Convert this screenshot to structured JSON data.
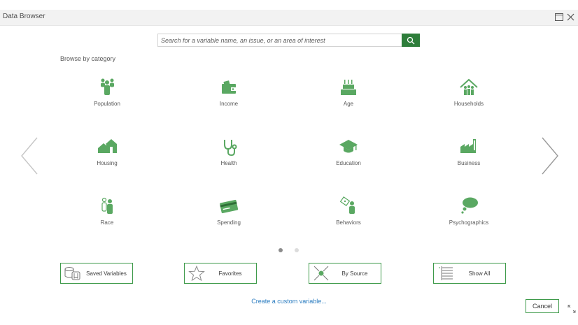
{
  "window": {
    "title": "Data Browser",
    "maximize_icon": "maximize-icon",
    "close_icon": "close-icon"
  },
  "search": {
    "placeholder": "Search for a variable name, an issue, or an area of interest",
    "value": "",
    "button_icon": "search-icon"
  },
  "browse_label": "Browse by category",
  "categories": [
    {
      "label": "Population",
      "icon": "population-icon"
    },
    {
      "label": "Income",
      "icon": "income-icon"
    },
    {
      "label": "Age",
      "icon": "age-icon"
    },
    {
      "label": "Households",
      "icon": "households-icon"
    },
    {
      "label": "Housing",
      "icon": "housing-icon"
    },
    {
      "label": "Health",
      "icon": "health-icon"
    },
    {
      "label": "Education",
      "icon": "education-icon"
    },
    {
      "label": "Business",
      "icon": "business-icon"
    },
    {
      "label": "Race",
      "icon": "race-icon"
    },
    {
      "label": "Spending",
      "icon": "spending-icon"
    },
    {
      "label": "Behaviors",
      "icon": "behaviors-icon"
    },
    {
      "label": "Psychographics",
      "icon": "psychographics-icon"
    }
  ],
  "pagination": {
    "pages": 2,
    "current": 1
  },
  "bottom_buttons": [
    {
      "label": "Saved Variables",
      "icon": "saved-variables-icon"
    },
    {
      "label": "Favorites",
      "icon": "star-icon"
    },
    {
      "label": "By Source",
      "icon": "source-icon"
    },
    {
      "label": "Show All",
      "icon": "list-icon"
    }
  ],
  "custom_link": "Create a custom variable...",
  "cancel_label": "Cancel",
  "colors": {
    "accent": "#2d7d3a",
    "icon_green": "#5aa862",
    "link": "#2a7cc0",
    "titlebar": "#f2f2f2"
  }
}
